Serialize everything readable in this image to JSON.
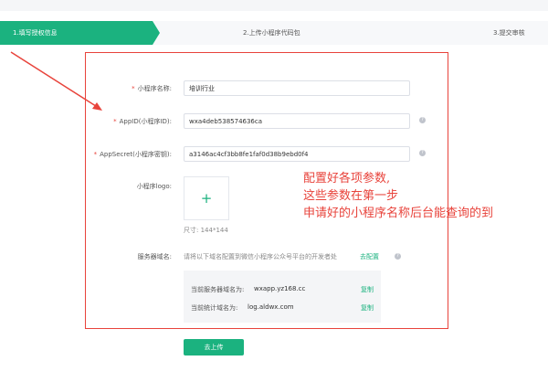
{
  "steps": [
    {
      "label": "1.填写授权信息"
    },
    {
      "label": "2.上传小程序代码包"
    },
    {
      "label": "3.提交审核"
    }
  ],
  "form": {
    "name": {
      "label": "小程序名称:",
      "value": "培训行业"
    },
    "appid": {
      "label": "AppID(小程序ID):",
      "value": "wxa4deb538574636ca"
    },
    "secret": {
      "label": "AppSecret(小程序密钥):",
      "value": "a3146ac4cf3bb8fe1faf0d38b9ebd0f4"
    },
    "logo": {
      "label": "小程序logo:",
      "plus": "+",
      "size_hint": "尺寸: 144*144"
    },
    "domain": {
      "label": "服务器域名:",
      "hint": "请将以下域名配置到微信小程序公众号平台的开发者处",
      "configure": "去配置",
      "server_label": "当前服务器域名为:",
      "server_value": "wxapp.yz168.cc",
      "stats_label": "当前统计域名为:",
      "stats_value": "log.aldwx.com",
      "copy": "复制"
    }
  },
  "help_icon": "?",
  "annotation": {
    "line1": "配置好各项参数,",
    "line2": "这些参数在第一步",
    "line3": "申请好的小程序名称后台能查询的到"
  },
  "submit_label": "去上传",
  "colors": {
    "accent": "#1bb27f",
    "annotation_red": "#e8433b"
  }
}
